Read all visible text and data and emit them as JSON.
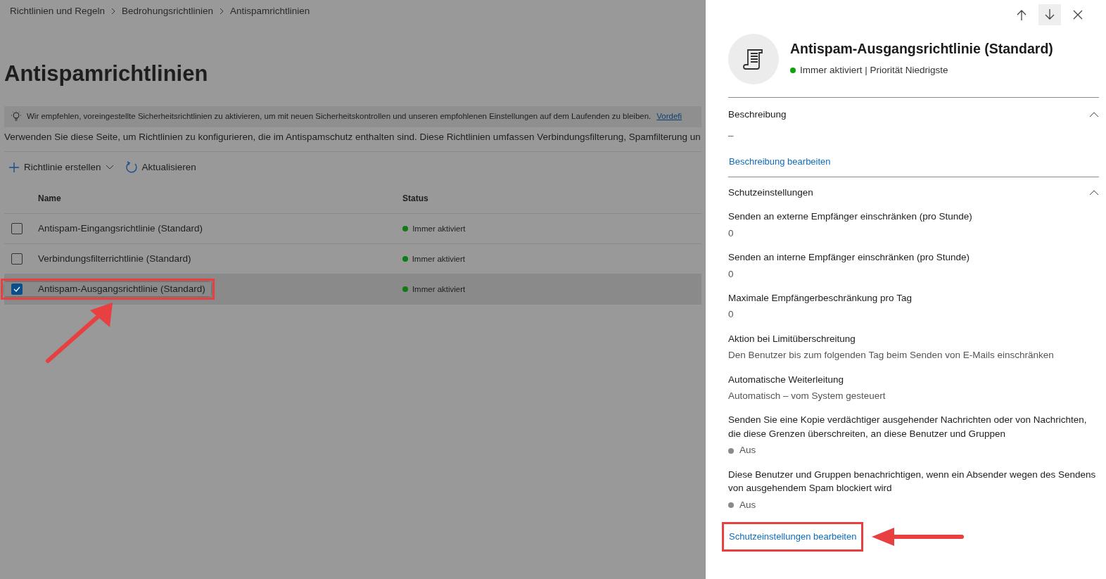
{
  "breadcrumb": [
    "Richtlinien und Regeln",
    "Bedrohungsrichtlinien",
    "Antispamrichtlinien"
  ],
  "page_title": "Antispamrichtlinien",
  "banner": {
    "text": "Wir empfehlen, voreingestellte Sicherheitsrichtlinien zu aktivieren, um mit neuen Sicherheitskontrollen und unseren empfohlenen Einstellungen auf dem Laufenden zu bleiben.",
    "link": "Vordefi"
  },
  "description": "Verwenden Sie diese Seite, um Richtlinien zu konfigurieren, die im Antispamschutz enthalten sind. Diese Richtlinien umfassen Verbindungsfilterung, Spamfilterung un",
  "toolbar": [
    {
      "kind": "create",
      "label": "Richtlinie erstellen"
    },
    {
      "kind": "refresh",
      "label": "Aktualisieren"
    }
  ],
  "table": {
    "columns": [
      "Name",
      "Status"
    ],
    "rows": [
      {
        "name": "Antispam-Eingangsrichtlinie (Standard)",
        "status": "Immer aktiviert",
        "color": "#107c10",
        "selected": false,
        "highlighted": false
      },
      {
        "name": "Verbindungsfilterrichtlinie (Standard)",
        "status": "Immer aktiviert",
        "color": "#107c10",
        "selected": false,
        "highlighted": false
      },
      {
        "name": "Antispam-Ausgangsrichtlinie (Standard)",
        "status": "Immer aktiviert",
        "color": "#107c10",
        "selected": true,
        "highlighted": true
      }
    ]
  },
  "panel": {
    "nav_buttons": [
      {
        "kind": "up",
        "highlighted": false
      },
      {
        "kind": "down",
        "highlighted": true
      },
      {
        "kind": "close",
        "highlighted": false
      }
    ],
    "title": "Antispam-Ausgangsrichtlinie (Standard)",
    "subtitle": {
      "text": "Immer aktiviert | Priorität Niedrigste",
      "color": "#13a10e"
    },
    "sections": [
      {
        "title": "Beschreibung",
        "expanded": true,
        "items": [
          {
            "kind": "text",
            "value": "–"
          }
        ],
        "edit_link": "Beschreibung bearbeiten",
        "highlighted": false
      },
      {
        "title": "Schutzeinstellungen",
        "expanded": true,
        "items": [
          {
            "kind": "text",
            "label": "Senden an externe Empfänger einschränken (pro Stunde)",
            "value": "0"
          },
          {
            "kind": "text",
            "label": "Senden an interne Empfänger einschränken (pro Stunde)",
            "value": "0"
          },
          {
            "kind": "text",
            "label": "Maximale Empfängerbeschränkung pro Tag",
            "value": "0"
          },
          {
            "kind": "text",
            "label": "Aktion bei Limitüberschreitung",
            "value": "Den Benutzer bis zum folgenden Tag beim Senden von E-Mails einschränken"
          },
          {
            "kind": "text",
            "label": "Automatische Weiterleitung",
            "value": "Automatisch – vom System gesteuert"
          },
          {
            "kind": "status",
            "label": "Senden Sie eine Kopie verdächtiger ausgehender Nachrichten oder von Nachrichten, die diese Grenzen überschreiten, an diese Benutzer und Gruppen",
            "value": "Aus"
          },
          {
            "kind": "status",
            "label": "Diese Benutzer und Gruppen benachrichtigen, wenn ein Absender wegen des Sendens von ausgehendem Spam blockiert wird",
            "value": "Aus"
          }
        ],
        "edit_link": "Schutzeinstellungen bearbeiten",
        "highlighted": true
      }
    ]
  }
}
